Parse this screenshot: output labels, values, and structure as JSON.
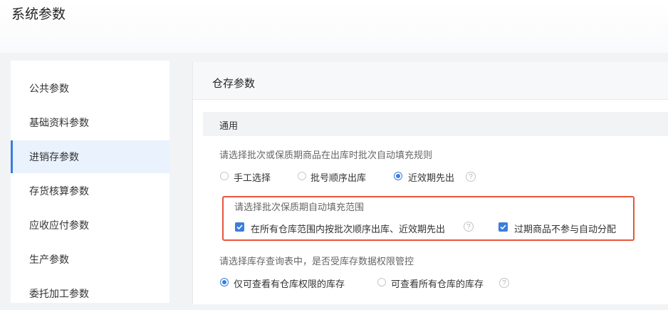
{
  "page": {
    "title": "系统参数"
  },
  "sidebar": {
    "items": [
      {
        "label": "公共参数"
      },
      {
        "label": "基础资料参数"
      },
      {
        "label": "进销存参数",
        "active": true
      },
      {
        "label": "存货核算参数"
      },
      {
        "label": "应收应付参数"
      },
      {
        "label": "生产参数"
      },
      {
        "label": "委托加工参数"
      }
    ]
  },
  "main": {
    "section_title": "仓存参数",
    "sub_title": "通用",
    "batch_rule": {
      "question": "请选择批次或保质期商品在出库时批次自动填充规则",
      "options": [
        {
          "label": "手工选择",
          "selected": false
        },
        {
          "label": "批号顺序出库",
          "selected": false
        },
        {
          "label": "近效期先出",
          "selected": true
        }
      ]
    },
    "fill_scope": {
      "question": "请选择批次保质期自动填充范围",
      "checks": [
        {
          "label": "在所有仓库范围内按批次顺序出库、近效期先出",
          "checked": true
        },
        {
          "label": "过期商品不参与自动分配",
          "checked": true
        }
      ]
    },
    "stock_query": {
      "question": "请选择库存查询表中，是否受库存数据权限管控",
      "options": [
        {
          "label": "仅可查看有仓库权限的库存",
          "selected": true
        },
        {
          "label": "可查看所有仓库的库存",
          "selected": false
        }
      ]
    }
  },
  "icons": {
    "help": "help-circle-icon",
    "check": "check-icon"
  },
  "colors": {
    "accent": "#3b7ddd",
    "highlight_border": "#e8553b"
  }
}
